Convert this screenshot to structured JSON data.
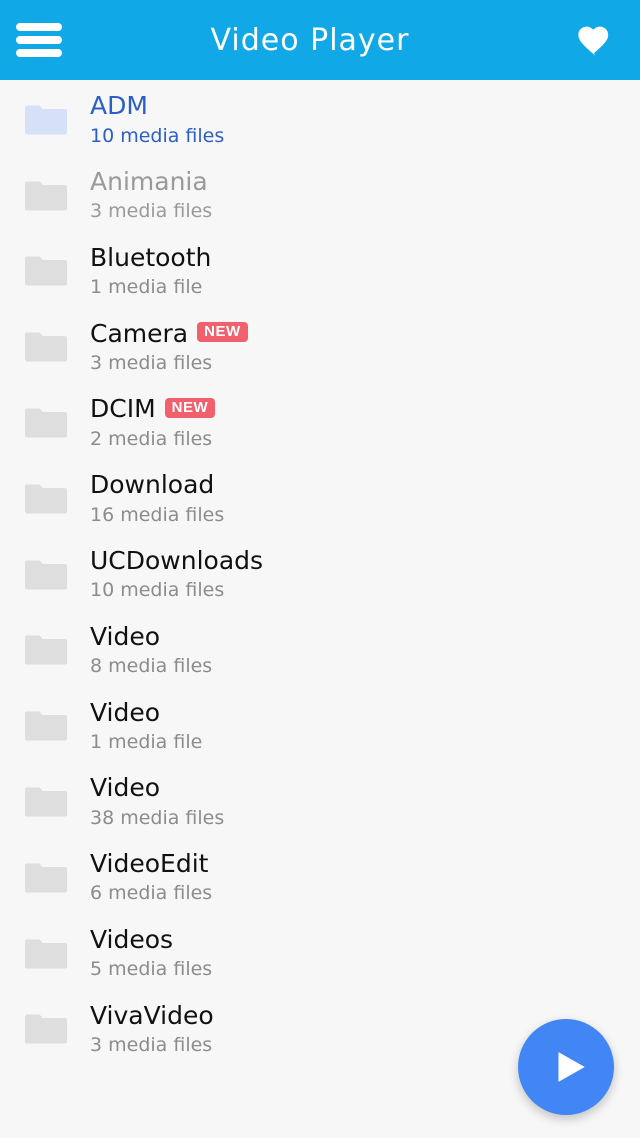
{
  "appbar": {
    "title": "Video Player",
    "menu_icon": "hamburger-menu-icon",
    "favorite_icon": "heart-icon",
    "background_color": "#11A8E8"
  },
  "fab": {
    "icon": "play-icon",
    "color": "#4285F4"
  },
  "colors": {
    "selected_text": "#2B5FC8",
    "dimmed_text": "#9A9A9A",
    "badge": "#F2606E",
    "folder_gray": "#DEDEDE",
    "folder_blue": "#D6E0F7",
    "list_background": "#F7F7F7"
  },
  "list": {
    "items": [
      {
        "name": "ADM",
        "count": "10 media files",
        "state": "sel",
        "badge": ""
      },
      {
        "name": "Animania",
        "count": "3 media files",
        "state": "dim",
        "badge": ""
      },
      {
        "name": "Bluetooth",
        "count": "1 media file",
        "state": "",
        "badge": ""
      },
      {
        "name": "Camera",
        "count": "3 media files",
        "state": "",
        "badge": "NEW"
      },
      {
        "name": "DCIM",
        "count": "2 media files",
        "state": "",
        "badge": "NEW"
      },
      {
        "name": "Download",
        "count": "16 media files",
        "state": "",
        "badge": ""
      },
      {
        "name": "UCDownloads",
        "count": "10 media files",
        "state": "",
        "badge": ""
      },
      {
        "name": "Video",
        "count": "8 media files",
        "state": "",
        "badge": ""
      },
      {
        "name": "Video",
        "count": "1 media file",
        "state": "",
        "badge": ""
      },
      {
        "name": "Video",
        "count": "38 media files",
        "state": "",
        "badge": ""
      },
      {
        "name": "VideoEdit",
        "count": "6 media files",
        "state": "",
        "badge": ""
      },
      {
        "name": "Videos",
        "count": "5 media files",
        "state": "",
        "badge": ""
      },
      {
        "name": "VivaVideo",
        "count": "3 media files",
        "state": "",
        "badge": ""
      }
    ]
  }
}
